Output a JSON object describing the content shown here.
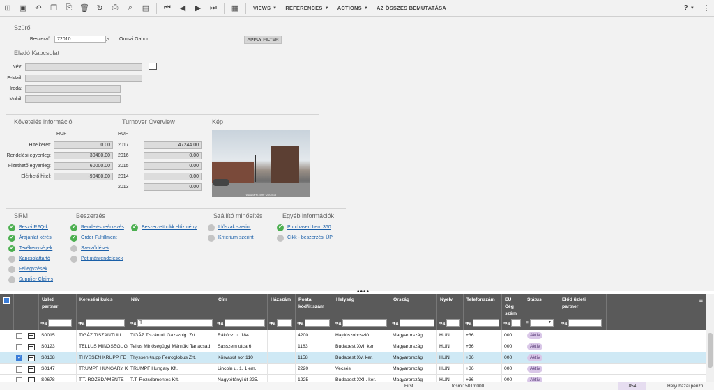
{
  "toolbar": {
    "menus": [
      {
        "label": "VIEWS"
      },
      {
        "label": "REFERENCES"
      },
      {
        "label": "ACTIONS"
      },
      {
        "label": "AZ ÖSSZES BEMUTATÁSA"
      }
    ],
    "help": "?"
  },
  "filter": {
    "title": "Szűrő",
    "supplier_label": "Beszerző:",
    "supplier_value": "72010",
    "supplier_name": "Oroszi Gabor",
    "apply_label": "APPLY FILTER"
  },
  "contact": {
    "title": "Eladó Kapcsolat",
    "name_label": "Név:",
    "email_label": "E-Mail:",
    "office_label": "Iroda:",
    "mobile_label": "Mobil:"
  },
  "credit": {
    "title": "Követelés információ",
    "currency": "HUF",
    "rows": [
      {
        "label": "Hitelkeret:",
        "value": "0.00"
      },
      {
        "label": "Rendelési egyenleg:",
        "value": "30480.00"
      },
      {
        "label": "Fizethető egyenleg:",
        "value": "60000.00"
      },
      {
        "label": "Elérhető hitel:",
        "value": "-90480.00"
      }
    ]
  },
  "turnover": {
    "title": "Turnover Overview",
    "currency": "HUF",
    "rows": [
      {
        "year": "2017",
        "value": "47244.00"
      },
      {
        "year": "2016",
        "value": "0.00"
      },
      {
        "year": "2015",
        "value": "0.00"
      },
      {
        "year": "2014",
        "value": "0.00"
      },
      {
        "year": "2013",
        "value": "0.00"
      }
    ]
  },
  "image": {
    "title": "Kép",
    "caption": "www.iarsi.com · 2009/15"
  },
  "srm": {
    "title": "SRM",
    "items": [
      {
        "label": "Besz-i RFQ-k",
        "status": "green"
      },
      {
        "label": "Árajánlat kérés",
        "status": "green"
      },
      {
        "label": "Tevékenységek",
        "status": "green"
      },
      {
        "label": "Kapcsolattartó",
        "status": "grey"
      },
      {
        "label": "Feljegyzések",
        "status": "grey"
      },
      {
        "label": "Supplier Claims",
        "status": "grey"
      }
    ]
  },
  "purchasing": {
    "title": "Beszerzés",
    "items": [
      {
        "label": "Rendelésbeérkezés",
        "status": "green"
      },
      {
        "label": "Order Fulfillment",
        "status": "green"
      },
      {
        "label": "Szerződések",
        "status": "grey"
      },
      {
        "label": "Pot utánrendelések",
        "status": "grey"
      }
    ],
    "extra": {
      "label": "Beszerzett cikk előzmény",
      "status": "green"
    }
  },
  "qualification": {
    "title": "Szállító minősítés",
    "items": [
      {
        "label": "Időszak szerint",
        "status": "grey"
      },
      {
        "label": "Kritérium szerint",
        "status": "grey"
      }
    ]
  },
  "other": {
    "title": "Egyéb információk",
    "items": [
      {
        "label": "Purchased Item 360",
        "status": "green"
      },
      {
        "label": "Cikk - beszerzési ÚP",
        "status": "grey"
      }
    ]
  },
  "grid": {
    "columns": [
      {
        "label": "Üzleti partner",
        "filter": ""
      },
      {
        "label": "Keresési kulcs",
        "filter": ""
      },
      {
        "label": "Név",
        "filter": "T"
      },
      {
        "label": "Cím",
        "filter": ""
      },
      {
        "label": "Házszám",
        "filter": ""
      },
      {
        "label": "Postai kód/ir.szám",
        "filter": ""
      },
      {
        "label": "Helység",
        "filter": ""
      },
      {
        "label": "Ország",
        "filter": ""
      },
      {
        "label": "Nyelv",
        "filter": ""
      },
      {
        "label": "Telefonszám",
        "filter": ""
      },
      {
        "label": "EU Cég szám",
        "filter": ""
      },
      {
        "label": "Státus",
        "filter": ""
      },
      {
        "label": "Előd üzleti partner",
        "filter": ""
      }
    ],
    "filter_arrow": "➜a",
    "filter_eq": "=",
    "rows": [
      {
        "partner": "S0015",
        "key": "TIGÁZ TISZANTULI",
        "name": "TIGÁZ Tiszántúli Gázszolg. Zrt.",
        "address": "Rákóczi u.  184.",
        "house": "",
        "zip": "4200",
        "city": "Hajdúszoboszló",
        "country": "Magyarország",
        "lang": "HUN",
        "phone": "+36",
        "eu": "000",
        "status": "Aktív",
        "selected": false
      },
      {
        "partner": "S0123",
        "key": "TELLUS MINOSEGUG",
        "name": "Tellus Minőségügyi Mérnöki Tanácsad",
        "address": "Sasszem utca 6.",
        "house": "",
        "zip": "1183",
        "city": "Budapest XVI. ker.",
        "country": "Magyarország",
        "lang": "HUN",
        "phone": "+36",
        "eu": "000",
        "status": "Aktív",
        "selected": false
      },
      {
        "partner": "S0138",
        "key": "THYSSEN KRUPP FE",
        "name": "ThyssenKrupp Ferroglobus Zrt.",
        "address": "Körvasút sor 110",
        "house": "",
        "zip": "1158",
        "city": "Budapest XV. ker.",
        "country": "Magyarország",
        "lang": "HUN",
        "phone": "+36",
        "eu": "000",
        "status": "Aktív",
        "selected": true
      },
      {
        "partner": "S0147",
        "key": "TRUMPF HUNGARY K",
        "name": "TRUMPF Hungary Kft.",
        "address": "Lincoln u. 1. 1.em.",
        "house": "",
        "zip": "2220",
        "city": "Vecsés",
        "country": "Magyarország",
        "lang": "HUN",
        "phone": "+36",
        "eu": "000",
        "status": "Aktív",
        "selected": false
      },
      {
        "partner": "S0678",
        "key": "T.T. ROZSDAMENTE",
        "name": "T.T. Rozsdamentes Kft.",
        "address": "Nagytétényi út 225.",
        "house": "",
        "zip": "1225",
        "city": "Budapest XXII. ker.",
        "country": "Magyarország",
        "lang": "HUN",
        "phone": "+36",
        "eu": "000",
        "status": "Aktív",
        "selected": false
      }
    ]
  },
  "statusbar": {
    "first": "First",
    "session": "tdsmi1501m000",
    "count": "854",
    "currency": "Helyi hazai pénzn..."
  }
}
